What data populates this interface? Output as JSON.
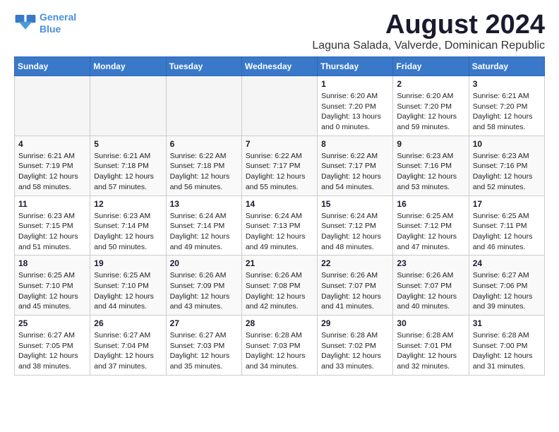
{
  "header": {
    "logo_line1": "General",
    "logo_line2": "Blue",
    "month_title": "August 2024",
    "location": "Laguna Salada, Valverde, Dominican Republic"
  },
  "days_of_week": [
    "Sunday",
    "Monday",
    "Tuesday",
    "Wednesday",
    "Thursday",
    "Friday",
    "Saturday"
  ],
  "weeks": [
    [
      {
        "day": "",
        "empty": true
      },
      {
        "day": "",
        "empty": true
      },
      {
        "day": "",
        "empty": true
      },
      {
        "day": "",
        "empty": true
      },
      {
        "day": "1",
        "sunrise": "Sunrise: 6:20 AM",
        "sunset": "Sunset: 7:20 PM",
        "daylight": "Daylight: 13 hours and 0 minutes."
      },
      {
        "day": "2",
        "sunrise": "Sunrise: 6:20 AM",
        "sunset": "Sunset: 7:20 PM",
        "daylight": "Daylight: 12 hours and 59 minutes."
      },
      {
        "day": "3",
        "sunrise": "Sunrise: 6:21 AM",
        "sunset": "Sunset: 7:20 PM",
        "daylight": "Daylight: 12 hours and 58 minutes."
      }
    ],
    [
      {
        "day": "4",
        "sunrise": "Sunrise: 6:21 AM",
        "sunset": "Sunset: 7:19 PM",
        "daylight": "Daylight: 12 hours and 58 minutes."
      },
      {
        "day": "5",
        "sunrise": "Sunrise: 6:21 AM",
        "sunset": "Sunset: 7:18 PM",
        "daylight": "Daylight: 12 hours and 57 minutes."
      },
      {
        "day": "6",
        "sunrise": "Sunrise: 6:22 AM",
        "sunset": "Sunset: 7:18 PM",
        "daylight": "Daylight: 12 hours and 56 minutes."
      },
      {
        "day": "7",
        "sunrise": "Sunrise: 6:22 AM",
        "sunset": "Sunset: 7:17 PM",
        "daylight": "Daylight: 12 hours and 55 minutes."
      },
      {
        "day": "8",
        "sunrise": "Sunrise: 6:22 AM",
        "sunset": "Sunset: 7:17 PM",
        "daylight": "Daylight: 12 hours and 54 minutes."
      },
      {
        "day": "9",
        "sunrise": "Sunrise: 6:23 AM",
        "sunset": "Sunset: 7:16 PM",
        "daylight": "Daylight: 12 hours and 53 minutes."
      },
      {
        "day": "10",
        "sunrise": "Sunrise: 6:23 AM",
        "sunset": "Sunset: 7:16 PM",
        "daylight": "Daylight: 12 hours and 52 minutes."
      }
    ],
    [
      {
        "day": "11",
        "sunrise": "Sunrise: 6:23 AM",
        "sunset": "Sunset: 7:15 PM",
        "daylight": "Daylight: 12 hours and 51 minutes."
      },
      {
        "day": "12",
        "sunrise": "Sunrise: 6:23 AM",
        "sunset": "Sunset: 7:14 PM",
        "daylight": "Daylight: 12 hours and 50 minutes."
      },
      {
        "day": "13",
        "sunrise": "Sunrise: 6:24 AM",
        "sunset": "Sunset: 7:14 PM",
        "daylight": "Daylight: 12 hours and 49 minutes."
      },
      {
        "day": "14",
        "sunrise": "Sunrise: 6:24 AM",
        "sunset": "Sunset: 7:13 PM",
        "daylight": "Daylight: 12 hours and 49 minutes."
      },
      {
        "day": "15",
        "sunrise": "Sunrise: 6:24 AM",
        "sunset": "Sunset: 7:12 PM",
        "daylight": "Daylight: 12 hours and 48 minutes."
      },
      {
        "day": "16",
        "sunrise": "Sunrise: 6:25 AM",
        "sunset": "Sunset: 7:12 PM",
        "daylight": "Daylight: 12 hours and 47 minutes."
      },
      {
        "day": "17",
        "sunrise": "Sunrise: 6:25 AM",
        "sunset": "Sunset: 7:11 PM",
        "daylight": "Daylight: 12 hours and 46 minutes."
      }
    ],
    [
      {
        "day": "18",
        "sunrise": "Sunrise: 6:25 AM",
        "sunset": "Sunset: 7:10 PM",
        "daylight": "Daylight: 12 hours and 45 minutes."
      },
      {
        "day": "19",
        "sunrise": "Sunrise: 6:25 AM",
        "sunset": "Sunset: 7:10 PM",
        "daylight": "Daylight: 12 hours and 44 minutes."
      },
      {
        "day": "20",
        "sunrise": "Sunrise: 6:26 AM",
        "sunset": "Sunset: 7:09 PM",
        "daylight": "Daylight: 12 hours and 43 minutes."
      },
      {
        "day": "21",
        "sunrise": "Sunrise: 6:26 AM",
        "sunset": "Sunset: 7:08 PM",
        "daylight": "Daylight: 12 hours and 42 minutes."
      },
      {
        "day": "22",
        "sunrise": "Sunrise: 6:26 AM",
        "sunset": "Sunset: 7:07 PM",
        "daylight": "Daylight: 12 hours and 41 minutes."
      },
      {
        "day": "23",
        "sunrise": "Sunrise: 6:26 AM",
        "sunset": "Sunset: 7:07 PM",
        "daylight": "Daylight: 12 hours and 40 minutes."
      },
      {
        "day": "24",
        "sunrise": "Sunrise: 6:27 AM",
        "sunset": "Sunset: 7:06 PM",
        "daylight": "Daylight: 12 hours and 39 minutes."
      }
    ],
    [
      {
        "day": "25",
        "sunrise": "Sunrise: 6:27 AM",
        "sunset": "Sunset: 7:05 PM",
        "daylight": "Daylight: 12 hours and 38 minutes."
      },
      {
        "day": "26",
        "sunrise": "Sunrise: 6:27 AM",
        "sunset": "Sunset: 7:04 PM",
        "daylight": "Daylight: 12 hours and 37 minutes."
      },
      {
        "day": "27",
        "sunrise": "Sunrise: 6:27 AM",
        "sunset": "Sunset: 7:03 PM",
        "daylight": "Daylight: 12 hours and 35 minutes."
      },
      {
        "day": "28",
        "sunrise": "Sunrise: 6:28 AM",
        "sunset": "Sunset: 7:03 PM",
        "daylight": "Daylight: 12 hours and 34 minutes."
      },
      {
        "day": "29",
        "sunrise": "Sunrise: 6:28 AM",
        "sunset": "Sunset: 7:02 PM",
        "daylight": "Daylight: 12 hours and 33 minutes."
      },
      {
        "day": "30",
        "sunrise": "Sunrise: 6:28 AM",
        "sunset": "Sunset: 7:01 PM",
        "daylight": "Daylight: 12 hours and 32 minutes."
      },
      {
        "day": "31",
        "sunrise": "Sunrise: 6:28 AM",
        "sunset": "Sunset: 7:00 PM",
        "daylight": "Daylight: 12 hours and 31 minutes."
      }
    ]
  ]
}
